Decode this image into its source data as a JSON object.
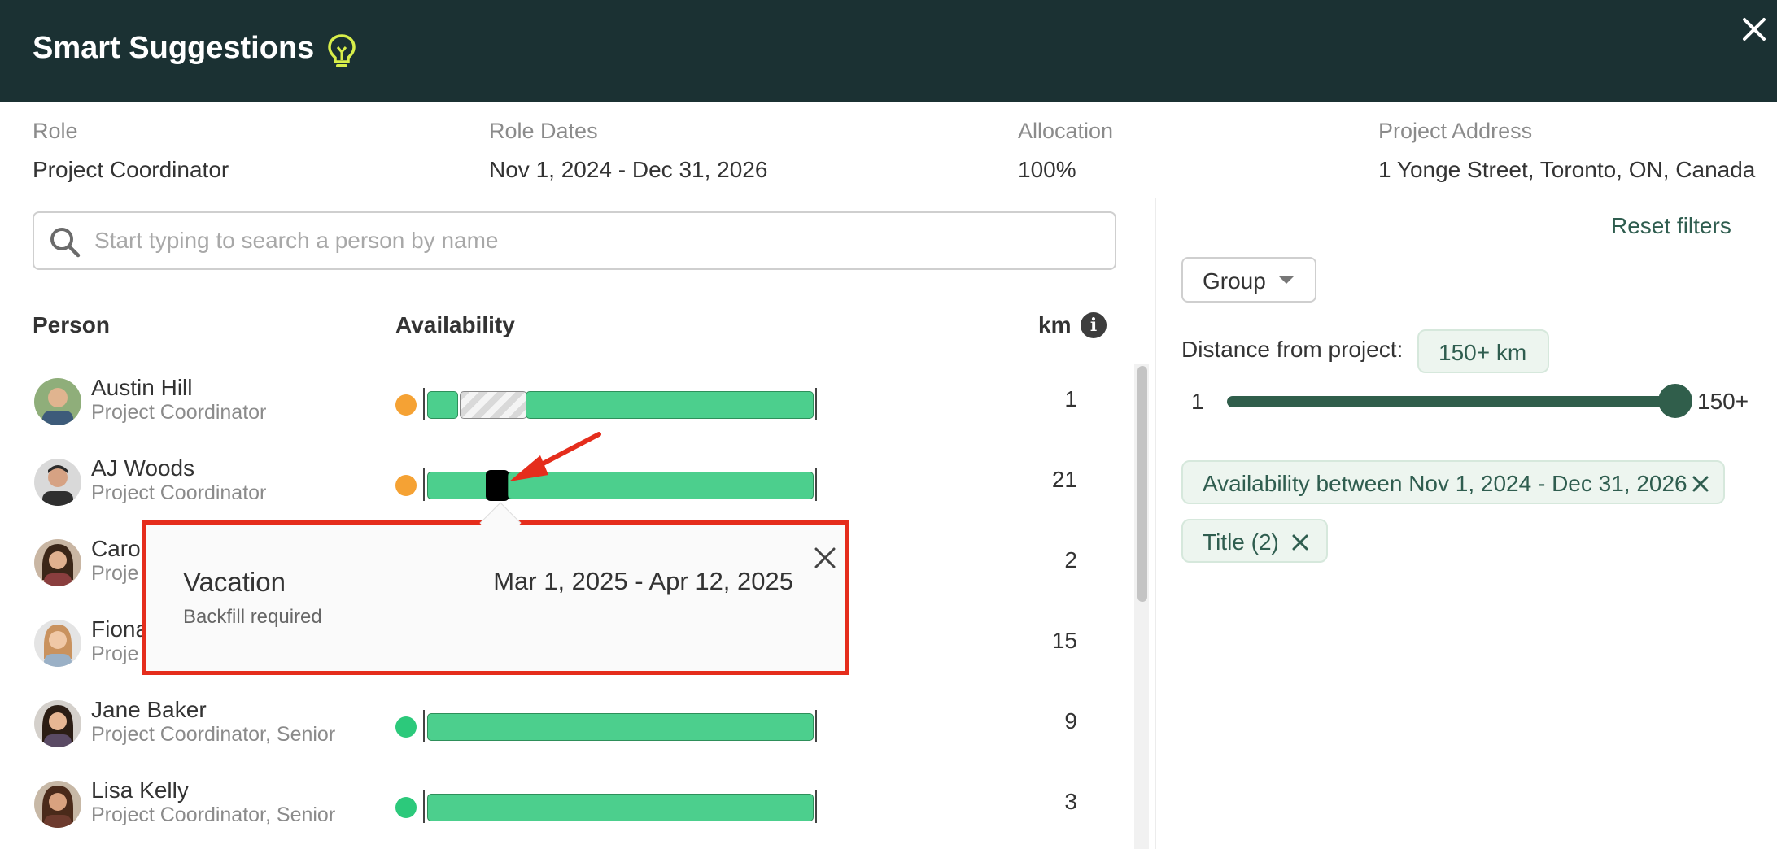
{
  "header": {
    "title": "Smart Suggestions",
    "bulb_icon": "lightbulb-icon",
    "close_icon": "close-icon"
  },
  "role_info": {
    "role": {
      "label": "Role",
      "value": "Project Coordinator"
    },
    "dates": {
      "label": "Role Dates",
      "value": "Nov 1, 2024 - Dec 31, 2026"
    },
    "allocation": {
      "label": "Allocation",
      "value": "100%"
    },
    "address": {
      "label": "Project Address",
      "value": "1 Yonge Street, Toronto, ON, Canada"
    }
  },
  "search": {
    "placeholder": "Start typing to search a person by name",
    "value": ""
  },
  "columns": {
    "person": "Person",
    "availability": "Availability",
    "km": "km"
  },
  "colors": {
    "header_bg": "#1b3133",
    "available": "#4ccf8d",
    "partial": "#f5a234",
    "full": "#2cc97b",
    "accent": "#2f5d4f",
    "highlight": "#e52d1c"
  },
  "people": [
    {
      "name": "Austin Hill",
      "title": "Project Coordinator",
      "km": "1",
      "status": "partial"
    },
    {
      "name": "AJ Woods",
      "title": "Project Coordinator",
      "km": "21",
      "status": "partial"
    },
    {
      "name": "Caro",
      "title": "Proje",
      "km": "2",
      "status": "partial"
    },
    {
      "name": "Fiona",
      "title": "Proje",
      "km": "15",
      "status": "partial"
    },
    {
      "name": "Jane Baker",
      "title": "Project Coordinator, Senior",
      "km": "9",
      "status": "full"
    },
    {
      "name": "Lisa Kelly",
      "title": "Project Coordinator, Senior",
      "km": "3",
      "status": "full"
    }
  ],
  "popup": {
    "type": "Vacation",
    "dates": "Mar 1, 2025 - Apr 12, 2025",
    "note": "Backfill required"
  },
  "filters": {
    "reset_label": "Reset filters",
    "group_label": "Group",
    "distance_label": "Distance from project:",
    "distance_value": "150+ km",
    "slider_min": "1",
    "slider_max": "150+",
    "slider_value_fraction": 1.0,
    "chips": [
      {
        "label": "Availability between Nov 1, 2024 - Dec 31, 2026"
      },
      {
        "label": "Title (2)"
      }
    ]
  }
}
